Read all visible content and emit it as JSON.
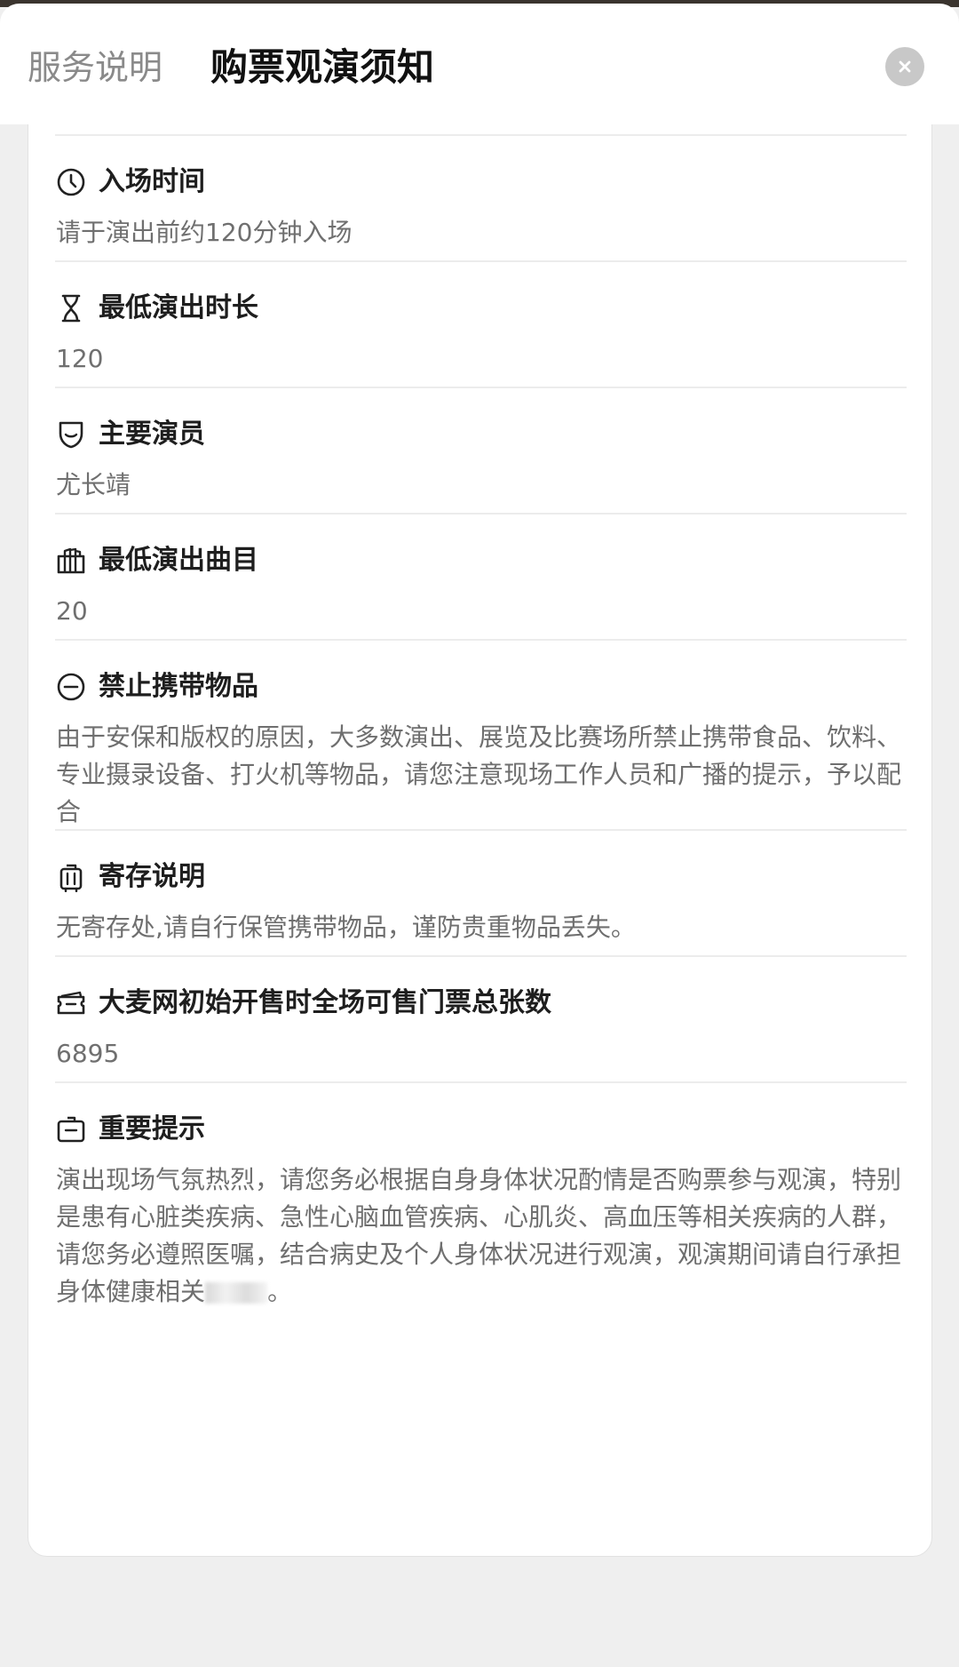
{
  "header": {
    "tab_service": "服务说明",
    "tab_notice": "购票观演须知",
    "close_icon": "close-icon"
  },
  "clipped_prev_text": "…",
  "sections": [
    {
      "icon": "clock-icon",
      "title": "入场时间",
      "body": "请于演出前约120分钟入场"
    },
    {
      "icon": "hourglass-icon",
      "title": "最低演出时长",
      "body": "120"
    },
    {
      "icon": "shield-icon",
      "title": "主要演员",
      "body": "尤长靖"
    },
    {
      "icon": "songlist-icon",
      "title": "最低演出曲目",
      "body": "20"
    },
    {
      "icon": "prohibited-icon",
      "title": "禁止携带物品",
      "body": "由于安保和版权的原因，大多数演出、展览及比赛场所禁止携带食品、饮料、专业摄录设备、打火机等物品，请您注意现场工作人员和广播的提示，予以配合"
    },
    {
      "icon": "luggage-icon",
      "title": "寄存说明",
      "body": "无寄存处,请自行保管携带物品，谨防贵重物品丢失。"
    },
    {
      "icon": "ticket-icon",
      "title": "大麦网初始开售时全场可售门票总张数",
      "body": "6895"
    },
    {
      "icon": "notice-icon",
      "title": "重要提示",
      "body": "演出现场气氛热烈，请您务必根据自身身体状况酌情是否购票参与观演，特别是患有心脏类疾病、急性心脑血管疾病、心肌炎、高血压等相关疾病的人群，请您务必遵照医嘱，结合病史及个人身体状况进行观演，观演期间请自行承担身体健康相关",
      "body_tail": "。"
    }
  ],
  "colors": {
    "accent_title": "#111111",
    "muted": "#8a8a8a",
    "body_text": "#6f6f6f",
    "divider": "#ececec"
  }
}
